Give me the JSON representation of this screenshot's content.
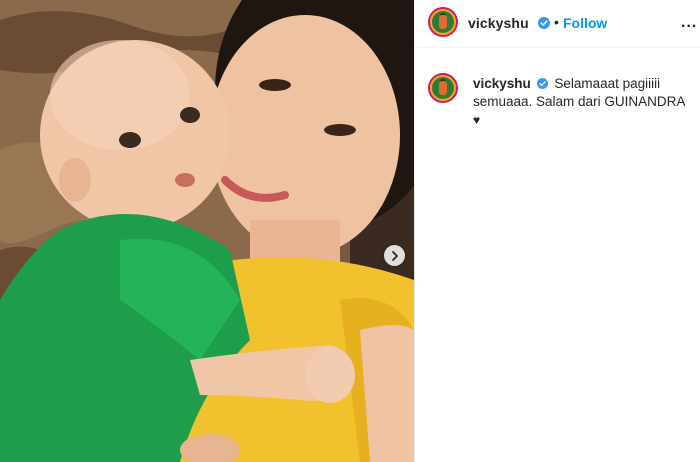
{
  "post": {
    "username": "vickyshu",
    "follow_label": "Follow",
    "separator": "•",
    "more_label": "...",
    "caption_text": "Selamaaat pagiiiii semuaaa. Salam dari GUINANDRA",
    "caption_emoji": "♥"
  },
  "icons": {
    "verified": "verified-badge-icon",
    "next": "chevron-right-icon",
    "more": "more-options-icon"
  },
  "colors": {
    "follow": "#0095f6",
    "verified": "#3897f0",
    "shirt_green": "#1e9e4a",
    "shirt_yellow": "#f2c12e"
  }
}
